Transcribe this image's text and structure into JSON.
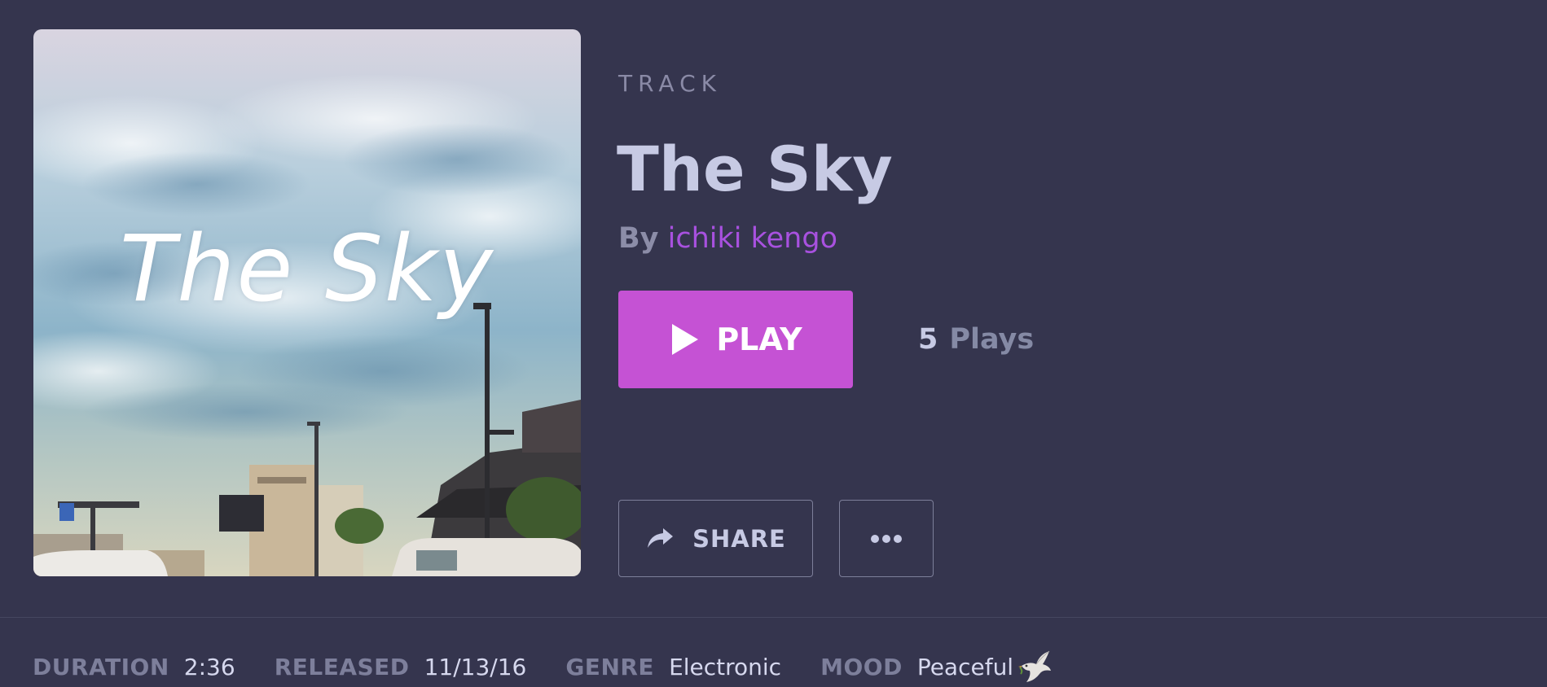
{
  "track": {
    "kind_label": "TRACK",
    "title": "The Sky",
    "cover_text": "The Sky",
    "by_label": "By",
    "artist": "ichiki kengo"
  },
  "actions": {
    "play_label": "PLAY",
    "plays_count": "5",
    "plays_label": "Plays",
    "share_label": "SHARE",
    "more_icon": "ellipsis-icon"
  },
  "meta": {
    "duration_label": "DURATION",
    "duration_value": "2:36",
    "released_label": "RELEASED",
    "released_value": "11/13/16",
    "genre_label": "GENRE",
    "genre_value": "Electronic",
    "mood_label": "MOOD",
    "mood_value": "Peaceful",
    "mood_icon": "dove-icon"
  },
  "colors": {
    "background": "#35354e",
    "accent": "#c552d4",
    "artist_link": "#a851df",
    "title": "#c7cae4"
  }
}
